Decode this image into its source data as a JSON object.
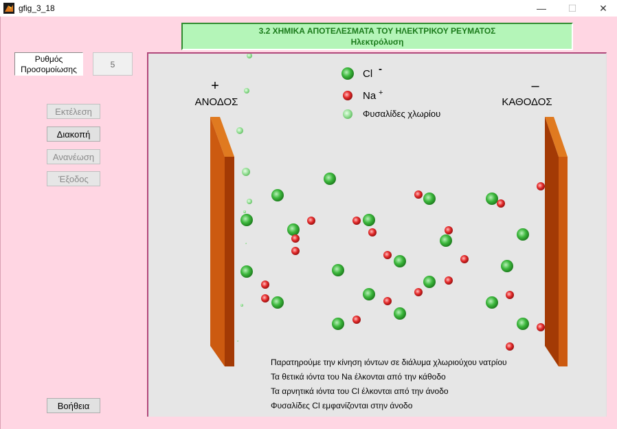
{
  "window": {
    "title": "gfig_3_18",
    "minimize": "—",
    "maximize": "☐",
    "close": "✕"
  },
  "header": {
    "title": "3.2 ΧΗΜΙΚΑ  ΑΠΟΤΕΛΕΣΜΑΤΑ ΤΟΥ ΗΛΕΚΤΡΙΚΟΥ ΡΕΥΜΑΤΟΣ",
    "subtitle": "Ηλεκτρόλυση"
  },
  "speed": {
    "label_line1": "Ρυθμός",
    "label_line2": "Προσομοίωσης",
    "value": "5"
  },
  "buttons": {
    "run": "Εκτέλεση",
    "stop": "Διακοπή",
    "refresh": "Ανανέωση",
    "exit": "Έξοδος",
    "help": "Βοήθεια"
  },
  "legend": {
    "cl": "Cl",
    "cl_charge": "-",
    "na": "Na",
    "na_charge": "+",
    "bubbles": "Φυσαλίδες χλωρίου"
  },
  "electrodes": {
    "anode_sign": "+",
    "anode_label": "ΑΝΟΔΟΣ",
    "cathode_sign": "–",
    "cathode_label": "ΚΑΘΟΔΟΣ"
  },
  "notes": [
    "Παρατηρούμε την κίνηση ιόντων σε διάλυμα χλωριούχου νατρίου",
    "Τα θετικά ιόντα του Na έλκονται από την κάθοδο",
    "Τα αρνητικά ιόντα του Cl έλκονται από την άνοδο",
    "Φυσαλίδες Cl εμφανίζονται στην άνοδο"
  ],
  "colors": {
    "cl": "#33aa33",
    "na": "#dd2222",
    "bubble": "#88dd88",
    "electrode": "#cc5a10",
    "header_bg": "#b4f5b8",
    "header_text": "#1a7a1a"
  }
}
